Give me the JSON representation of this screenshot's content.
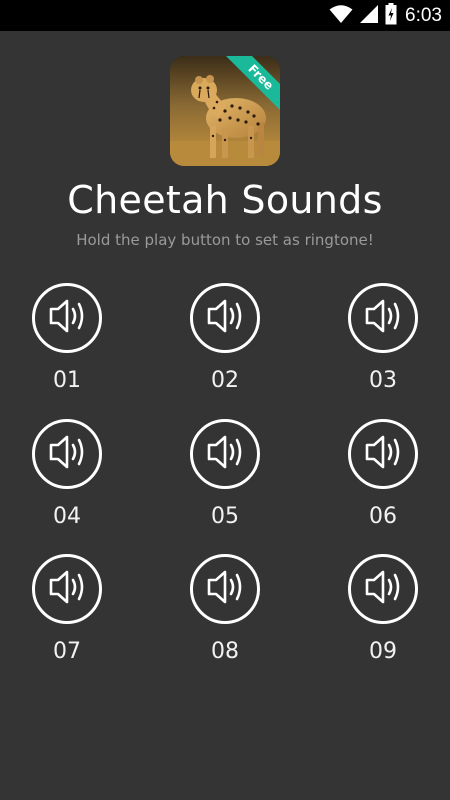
{
  "status_bar": {
    "time": "6:03",
    "icons": [
      "wifi-icon",
      "signal-icon",
      "battery-icon"
    ],
    "battery_level": 0.6
  },
  "app": {
    "title": "Cheetah Sounds",
    "subtitle": "Hold the play button to set as ringtone!",
    "badge": "Free",
    "icon": "cheetah-image"
  },
  "colors": {
    "background": "#343434",
    "badge": "#19b99a",
    "status_bar": "#000000"
  },
  "sounds": [
    {
      "label": "01",
      "icon": "speaker-icon"
    },
    {
      "label": "02",
      "icon": "speaker-icon"
    },
    {
      "label": "03",
      "icon": "speaker-icon"
    },
    {
      "label": "04",
      "icon": "speaker-icon"
    },
    {
      "label": "05",
      "icon": "speaker-icon"
    },
    {
      "label": "06",
      "icon": "speaker-icon"
    },
    {
      "label": "07",
      "icon": "speaker-icon"
    },
    {
      "label": "08",
      "icon": "speaker-icon"
    },
    {
      "label": "09",
      "icon": "speaker-icon"
    }
  ]
}
